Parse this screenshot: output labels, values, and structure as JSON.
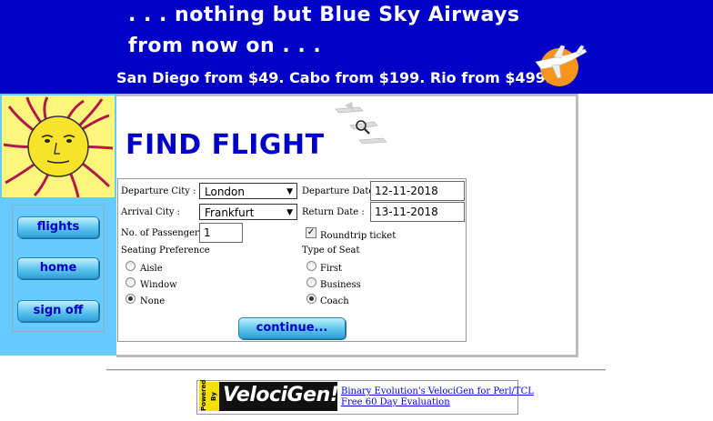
{
  "banner": {
    "line1": ". . . nothing but Blue Sky Airways",
    "line2": "from now on . . .",
    "prices": "San Diego from $49. Cabo from $199. Rio from $499."
  },
  "nav": {
    "flights": "flights",
    "home": "home",
    "sign_off": "sign off"
  },
  "main": {
    "title": "FIND FLIGHT"
  },
  "form": {
    "departure_city_label": "Departure City :",
    "departure_city_value": "London",
    "departure_date_label": "Departure Date :",
    "departure_date_value": "12-11-2018",
    "arrival_city_label": "Arrival City :",
    "arrival_city_value": "Frankfurt",
    "return_date_label": "Return Date :",
    "return_date_value": "13-11-2018",
    "passengers_label": "No. of Passengers :",
    "passengers_value": "1",
    "roundtrip_label": "Roundtrip ticket",
    "roundtrip_checked": true,
    "seating_pref_label": "Seating Preference",
    "seating_options": [
      "Aisle",
      "Window",
      "None"
    ],
    "seating_selected": "None",
    "seat_type_label": "Type of Seat",
    "seat_type_options": [
      "First",
      "Business",
      "Coach"
    ],
    "seat_type_selected": "Coach",
    "continue_label": "continue..."
  },
  "footer": {
    "badge_text": "VelociGen!",
    "badge_strip": "Powered By",
    "link1": "Binary Evolution's VelociGen for Perl/TCL",
    "link2": "Free 60 Day Evaluation"
  },
  "colors": {
    "banner_bg": "#0000c6",
    "sidebar_bg": "#66ccff",
    "title_color": "#0000c6",
    "button_text": "#0000c6"
  }
}
